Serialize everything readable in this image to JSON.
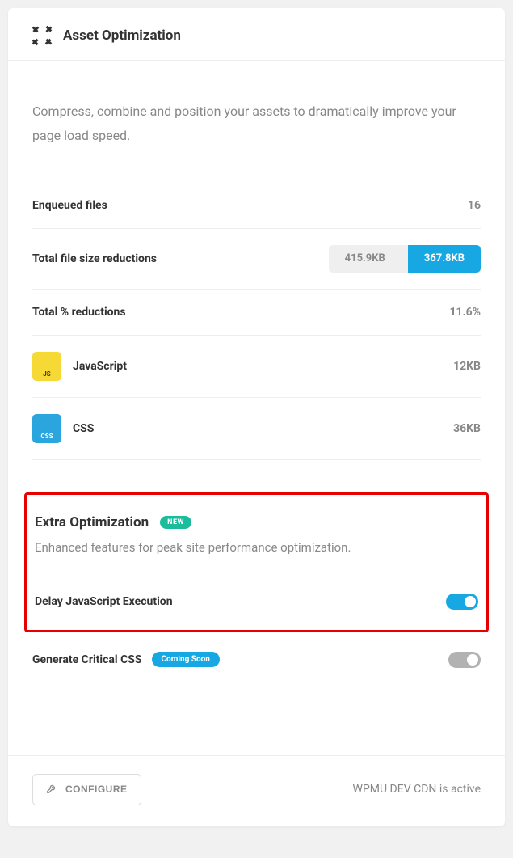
{
  "header": {
    "title": "Asset Optimization"
  },
  "description": "Compress, combine and position your assets to dramatically improve your page load speed.",
  "stats": {
    "enqueued_label": "Enqueued files",
    "enqueued_value": "16",
    "size_reduction_label": "Total file size reductions",
    "size_before": "415.9KB",
    "size_after": "367.8KB",
    "pct_reduction_label": "Total % reductions",
    "pct_reduction_value": "11.6%",
    "js_label": "JavaScript",
    "js_value": "12KB",
    "css_label": "CSS",
    "css_value": "36KB"
  },
  "extra": {
    "heading": "Extra Optimization",
    "badge": "NEW",
    "description": "Enhanced features for peak site performance optimization.",
    "toggles": {
      "delay_js_label": "Delay JavaScript Execution",
      "critical_css_label": "Generate Critical CSS",
      "coming_soon": "Coming Soon"
    }
  },
  "footer": {
    "configure": "CONFIGURE",
    "status": "WPMU DEV CDN is active"
  },
  "icons": {
    "js": "JS",
    "css": "CSS"
  }
}
